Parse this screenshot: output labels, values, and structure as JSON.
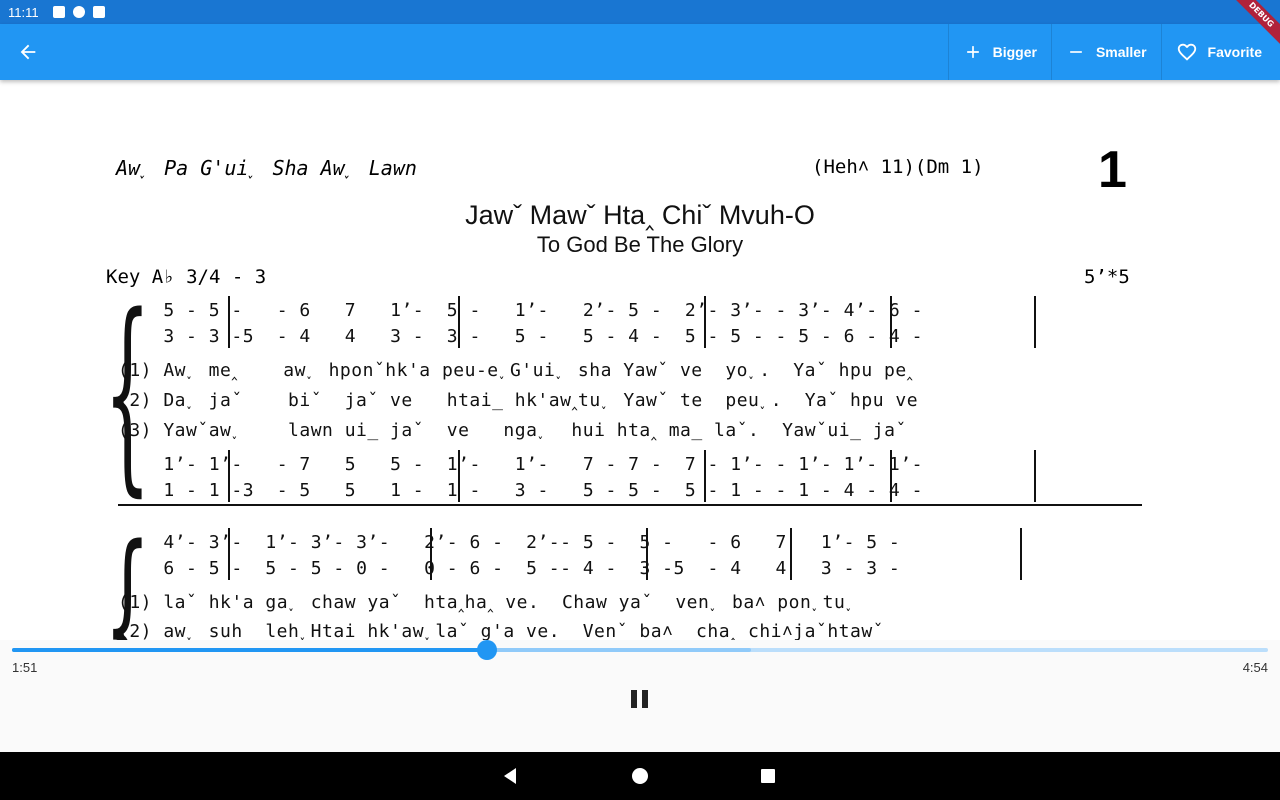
{
  "status_bar": {
    "time": "11:11"
  },
  "app_bar": {
    "bigger_label": "Bigger",
    "smaller_label": "Smaller",
    "favorite_label": "Favorite",
    "debug_label": "DEBUG",
    "color": "#2196f3"
  },
  "hymn": {
    "header_left": "Aw˯ Pa G'ui˯ Sha Aw˯ Lawn",
    "header_ref": "(Heh˄ 11)(Dm 1)",
    "number": "1",
    "title": "Jawˇ Mawˇ Hta‸ Chiˇ Mvuh-O",
    "subtitle": "To God Be The Glory",
    "key": "Key A♭  3/4 - 3",
    "tempo": "5’*5",
    "system1": {
      "soprano": "    5 - 5 -   - 6   7   1’-  5 -   1’-   2’- 5 -  2’- 3’- - 3’- 4’- 6 -",
      "alto": "    3 - 3 -5  - 4   4   3 -  3 -   5 -   5 - 4 -  5 - 5 - - 5 - 6 - 4 -",
      "v1": "(1) Aw˯ me‸    aw˯ hponˇhk'a peu-e˯G'ui˯ sha Yawˇ ve  yo˯.  Yaˇ hpu pe‸",
      "v2": "(2) Da˯ jaˇ    biˇ  jaˇ ve   htai_ hk'aw‸tu˯ Yawˇ te  peu˯.  Yaˇ hpu ve",
      "v3": "(3) Yawˇaw˯    lawn ui_ jaˇ  ve   nga˯  hui hta‸ ma_ laˇ.  Yawˇui_ jaˇ",
      "tenor": "    1’- 1’-   - 7   5   5 -  1’-   1’-   7 - 7 -  7 - 1’- - 1’- 1’- 1’-",
      "bass": "    1 - 1 -3  - 5   5   1 -  1 -   3 -   5 - 5 -  5 - 1 - - 1 - 4 - 4 -"
    },
    "system2": {
      "soprano": "    4’- 3’-  1’- 3’- 3’-   2’- 6 -  2’-- 5 -  5 -   - 6   7   1’- 5 -",
      "alto": "    6 - 5 -  5 - 5 - 0 -   0 - 6 -  5 -- 4 -  3 -5  - 4   4   3 - 3 -",
      "v1": "(1) laˇ hk'a ga˯ chaw yaˇ  hta‸ha‸ ve.  Chaw yaˇ  ven˯ ba˄ pon˯tu˯",
      "v2": "(2) aw˯ suh_ leh˯Htai_hk'aw˯laˇ g'a ve.  Venˇ ba˄  cha‸ chi˄jaˇhtawˇ"
    }
  },
  "player": {
    "current_time": "1:51",
    "total_time": "4:54",
    "progress": 0.378,
    "buffered": 0.588,
    "accent": "#2196f3"
  }
}
